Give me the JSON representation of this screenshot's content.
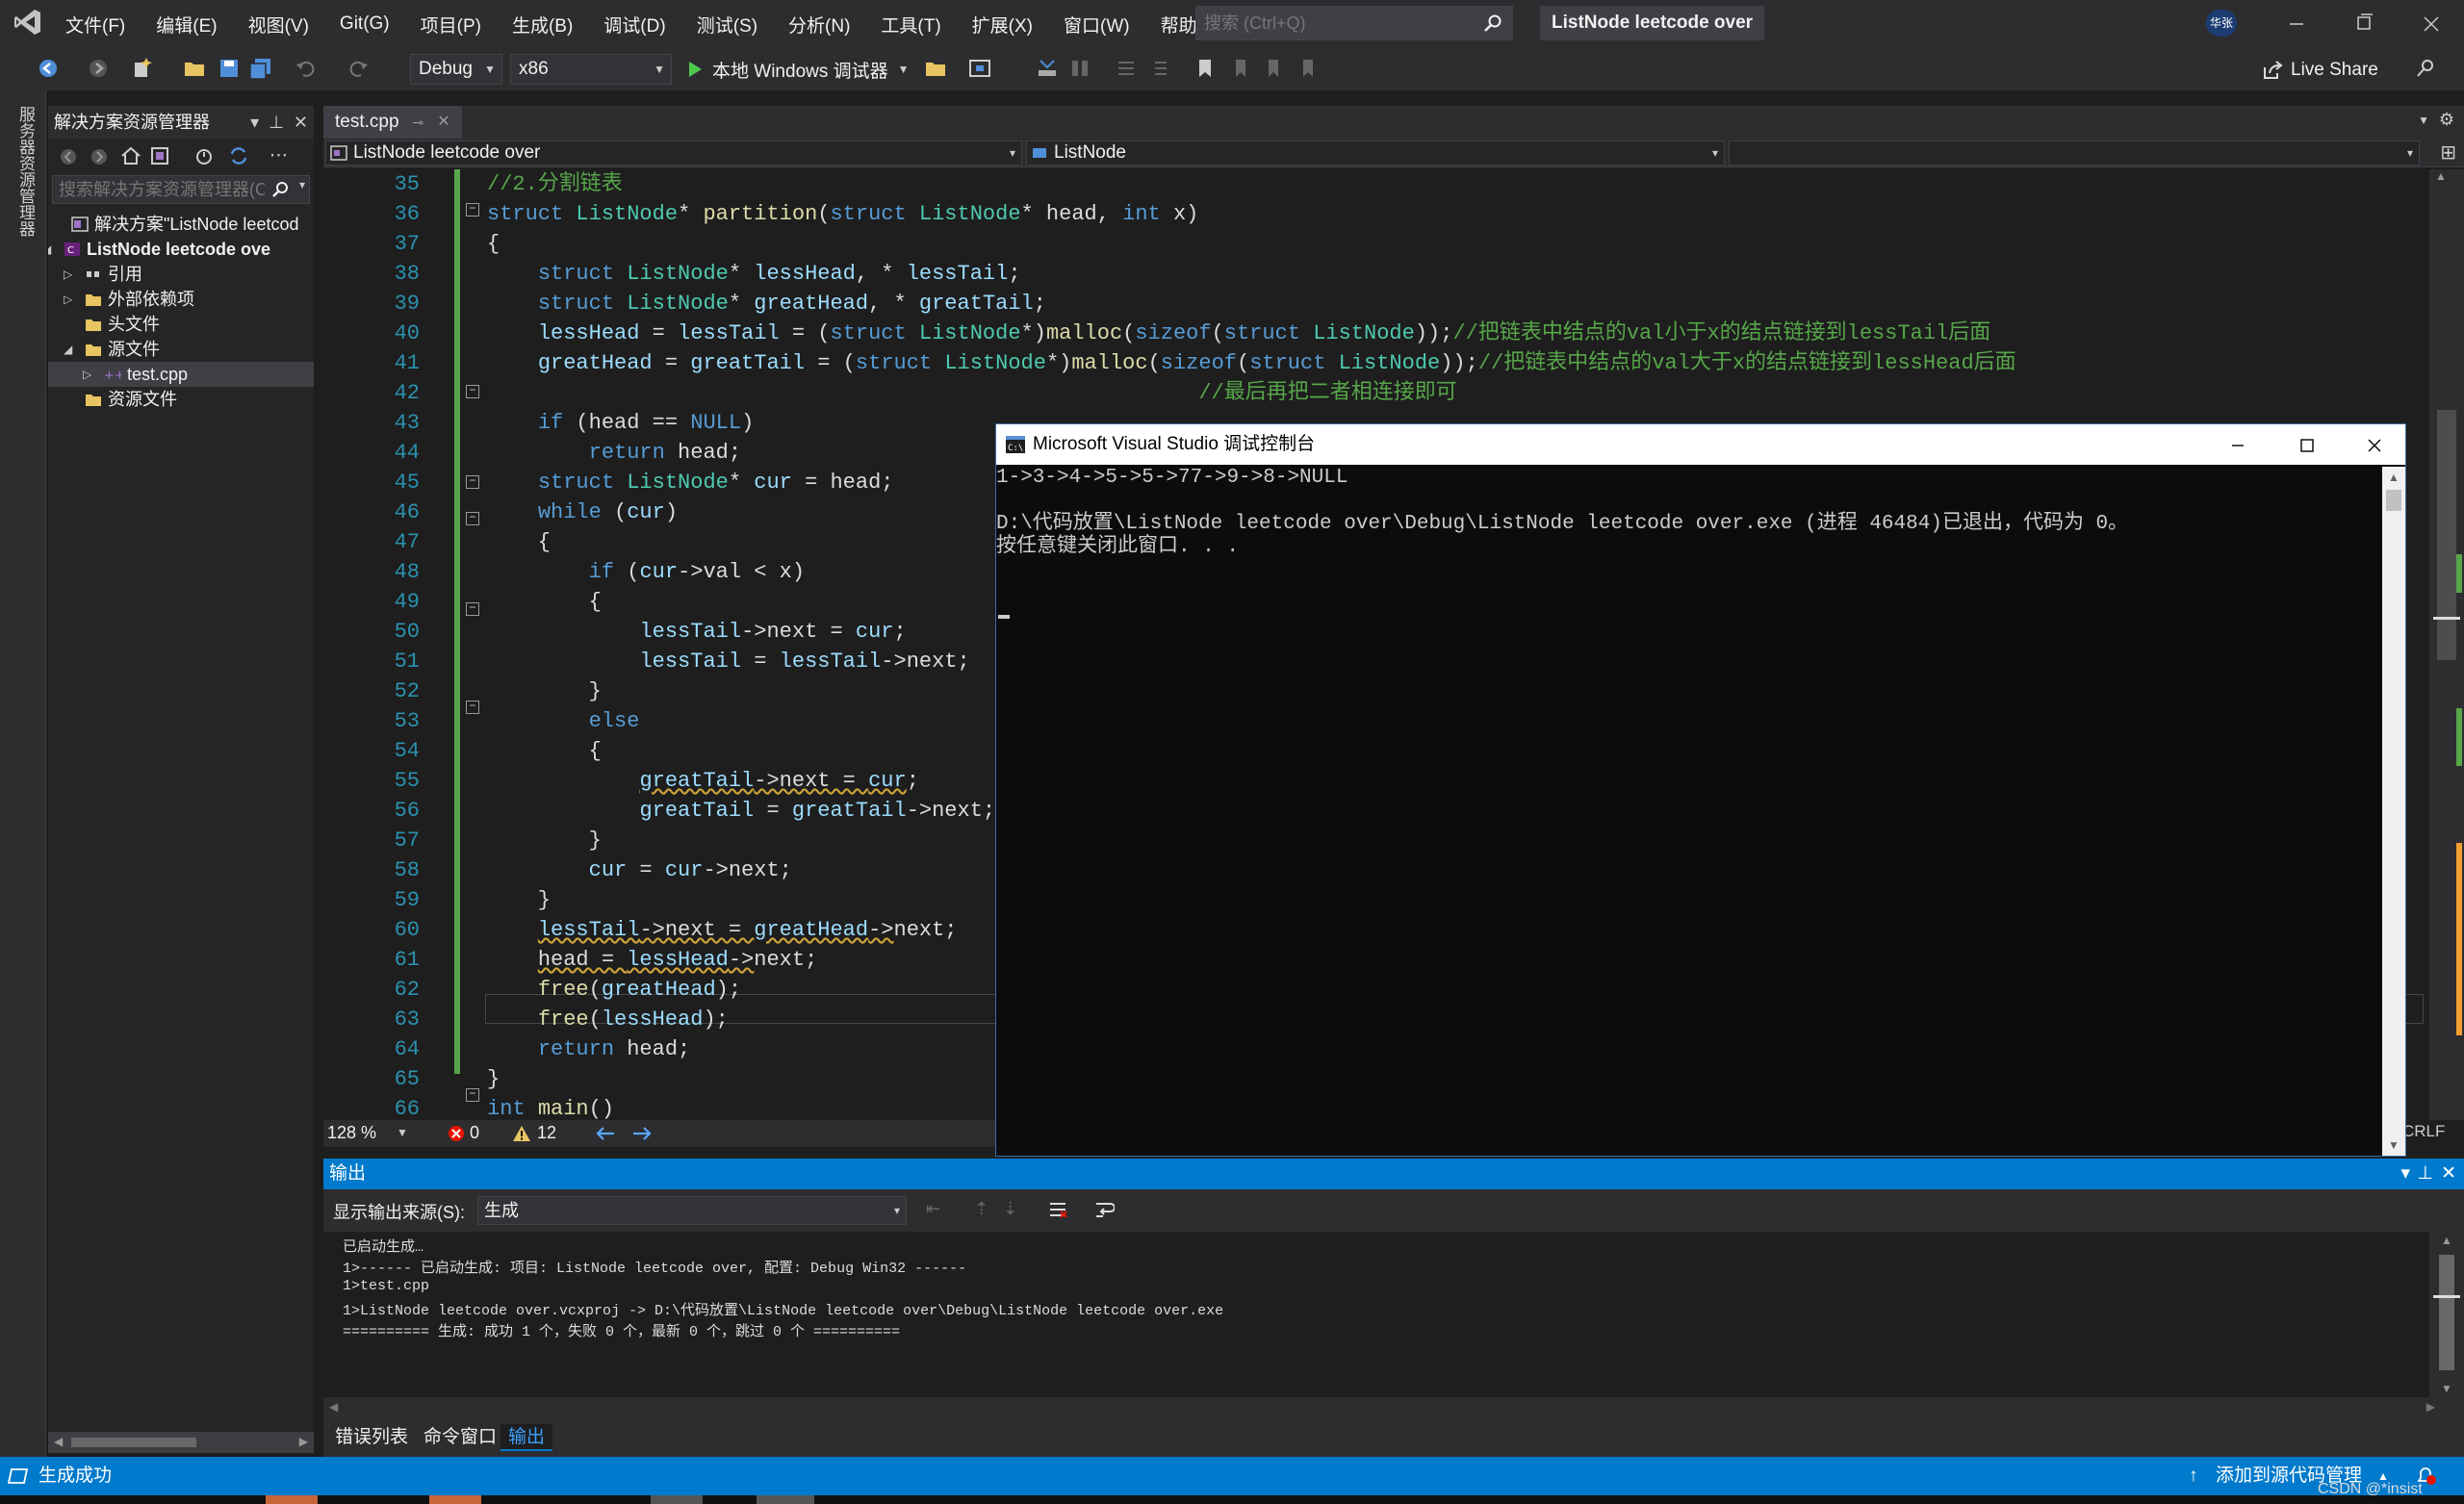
{
  "menubar": {
    "items": [
      "文件(F)",
      "编辑(E)",
      "视图(V)",
      "Git(G)",
      "项目(P)",
      "生成(B)",
      "调试(D)",
      "测试(S)",
      "分析(N)",
      "工具(T)",
      "扩展(X)",
      "窗口(W)",
      "帮助(H)"
    ],
    "search_placeholder": "搜索 (Ctrl+Q)",
    "solution_title": "ListNode leetcode over",
    "user_badge": "华张"
  },
  "toolbar": {
    "configuration": "Debug",
    "platform": "x86",
    "run_label": "本地 Windows 调试器",
    "live_share": "Live Share"
  },
  "left_strip": {
    "label": "服务器资源管理器"
  },
  "solution_explorer": {
    "title": "解决方案资源管理器",
    "search_placeholder": "搜索解决方案资源管理器(C",
    "tree": [
      {
        "label": "解决方案\"ListNode leetcod",
        "level": 0,
        "expander": "",
        "bold": false
      },
      {
        "label": "ListNode leetcode ove",
        "level": 0,
        "expander": "◢",
        "bold": true
      },
      {
        "label": "引用",
        "level": 1,
        "expander": "▷",
        "bold": false
      },
      {
        "label": "外部依赖项",
        "level": 1,
        "expander": "▷",
        "bold": false
      },
      {
        "label": "头文件",
        "level": 1,
        "expander": "",
        "bold": false
      },
      {
        "label": "源文件",
        "level": 1,
        "expander": "◢",
        "bold": false
      },
      {
        "label": "test.cpp",
        "level": 2,
        "expander": "▷",
        "bold": false
      },
      {
        "label": "资源文件",
        "level": 1,
        "expander": "",
        "bold": false
      }
    ]
  },
  "editor": {
    "tab_label": "test.cpp",
    "nav_project": "ListNode leetcode over",
    "nav_symbol": "ListNode",
    "zoom": "128 %",
    "errors": "0",
    "warnings": "12",
    "line_ending": "CRLF",
    "line_numbers": [
      "35",
      "36",
      "37",
      "38",
      "39",
      "40",
      "41",
      "42",
      "43",
      "44",
      "45",
      "46",
      "47",
      "48",
      "49",
      "50",
      "51",
      "52",
      "53",
      "54",
      "55",
      "56",
      "57",
      "58",
      "59",
      "60",
      "61",
      "62",
      "63",
      "64",
      "65",
      "66"
    ]
  },
  "console": {
    "title": "Microsoft Visual Studio 调试控制台",
    "lines": [
      "1->3->4->5->5->77->9->8->NULL",
      "",
      "D:\\代码放置\\ListNode leetcode over\\Debug\\ListNode leetcode over.exe (进程 46484)已退出，代码为 0。",
      "按任意键关闭此窗口. . ."
    ]
  },
  "output": {
    "title": "输出",
    "source_label": "显示输出来源(S):",
    "source_value": "生成",
    "lines": [
      "已启动生成…",
      "1>------ 已启动生成: 项目: ListNode leetcode over, 配置: Debug Win32 ------",
      "1>test.cpp",
      "1>ListNode leetcode over.vcxproj -> D:\\代码放置\\ListNode leetcode over\\Debug\\ListNode leetcode over.exe",
      "========== 生成: 成功 1 个，失败 0 个，最新 0 个，跳过 0 个 =========="
    ]
  },
  "bottom_tabs": [
    "错误列表",
    "命令窗口",
    "输出"
  ],
  "statusbar": {
    "status": "生成成功",
    "source_control": "添加到源代码管理",
    "watermark": "CSDN @*insist"
  },
  "colors": {
    "accent": "#007acc",
    "keyword": "#569cd6",
    "type": "#4ec9b0",
    "comment": "#57a64a",
    "line_number": "#2b91af"
  }
}
